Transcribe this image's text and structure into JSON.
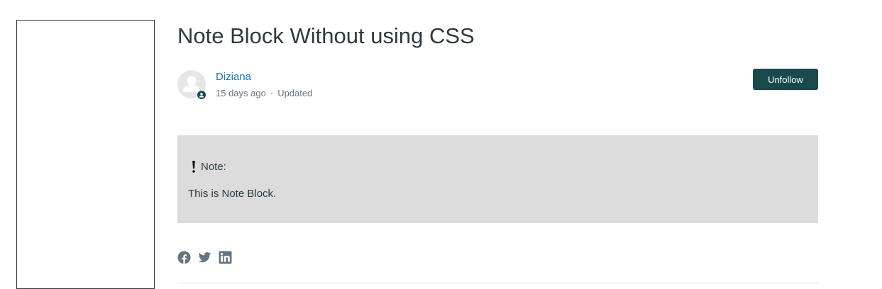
{
  "article": {
    "title": "Note Block Without using CSS",
    "author": {
      "name": "Diziana",
      "posted": "15 days ago",
      "separator": "·",
      "status": "Updated"
    },
    "follow_button": "Unfollow",
    "note": {
      "heading": "Note:",
      "body": "This is Note Block."
    }
  },
  "share": {
    "icons": [
      "facebook-icon",
      "twitter-icon",
      "linkedin-icon"
    ]
  },
  "colors": {
    "title": "#2f3941",
    "link": "#1f73b7",
    "button_bg": "#17494d",
    "note_bg": "#dcdcdc",
    "muted": "#68737d",
    "share_icon": "#68737d"
  }
}
